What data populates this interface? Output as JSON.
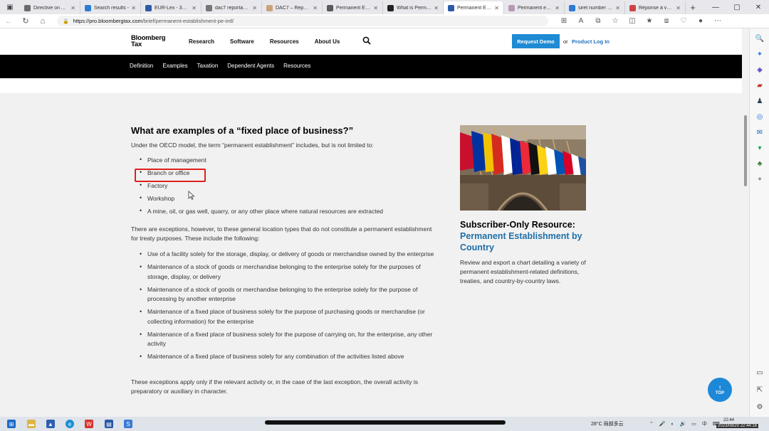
{
  "browser": {
    "tabs": [
      {
        "label": "Directive on Ad...",
        "fav": "#6a6a6a"
      },
      {
        "label": "Search results -",
        "fav": "#2e7bd6"
      },
      {
        "label": "EUR-Lex - 3202...",
        "fav": "#2b5aa8"
      },
      {
        "label": "dac7 reportabl...",
        "fav": "#777"
      },
      {
        "label": "DAC7 – Reportin...",
        "fav": "#c8a47a"
      },
      {
        "label": "Permanent Esta...",
        "fav": "#5a5a5a"
      },
      {
        "label": "What is Perman...",
        "fav": "#222"
      },
      {
        "label": "Permanent Esta",
        "fav": "#2b5aa8"
      },
      {
        "label": "Permanent esta...",
        "fav": "#b59ab8"
      },
      {
        "label": "siret number ch...",
        "fav": "#2e7bd6"
      },
      {
        "label": "Réponse à vos q...",
        "fav": "#c44"
      }
    ],
    "active_tab_index": 7,
    "url_host": "https://pro.bloombergtax.com",
    "url_path": "/brief/permanent-establishment-pe-intl/"
  },
  "site": {
    "logo_line1": "Bloomberg",
    "logo_line2": "Tax",
    "nav": [
      "Research",
      "Software",
      "Resources",
      "About Us"
    ],
    "request_demo": "Request Demo",
    "or": "or",
    "product_login": "Product Log In",
    "subnav": [
      "Definition",
      "Examples",
      "Taxation",
      "Dependent Agents",
      "Resources"
    ]
  },
  "article": {
    "heading": "What are examples of a “fixed place of business?”",
    "intro": "Under the OECD model, the term “permanent establishment” includes, but is not limited to:",
    "list1": [
      "Place of management",
      "Branch or office",
      "Factory",
      "Workshop",
      "A mine, oil, or gas well, quarry, or any other place where natural resources are extracted"
    ],
    "para2": "There are exceptions, however, to these general location types that do not constitute a permanent establishment for treaty purposes. These include the following:",
    "list2": [
      "Use of a facility solely for the storage, display, or delivery of goods or merchandise owned by the enterprise",
      "Maintenance of a stock of goods or merchandise belonging to the enterprise solely for the purposes of storage, display, or delivery",
      "Maintenance of a stock of goods or merchandise belonging to the enterprise solely for the purpose of processing by another enterprise",
      "Maintenance of a fixed place of business solely for the purpose of purchasing goods or merchandise (or collecting information) for the enterprise",
      "Maintenance of a fixed place of business solely for the purpose of carrying on, for the enterprise, any other activity",
      "Maintenance of a fixed place of business solely for any combination of the activities listed above"
    ],
    "para3": "These exceptions apply only if the relevant activity or, in the case of the last exception, the overall activity is preparatory or auxiliary in character."
  },
  "resource": {
    "title": "Subscriber-Only Resource:",
    "subtitle": "Permanent Establishment by Country",
    "description": "Review and export a chart detailing a variety of permanent establishment-related definitions, treaties, and country-by-country laws."
  },
  "top_button": "TOP",
  "taskbar": {
    "weather": "28°C 局部多云",
    "time": "22:44",
    "date": "2023/08/20",
    "stamp": "2023/08/20 22:44:16"
  },
  "colors": {
    "accent": "#1e8bd4",
    "link": "#1e73be",
    "resource_blue": "#1f6fa8",
    "highlight": "#e0201b"
  }
}
